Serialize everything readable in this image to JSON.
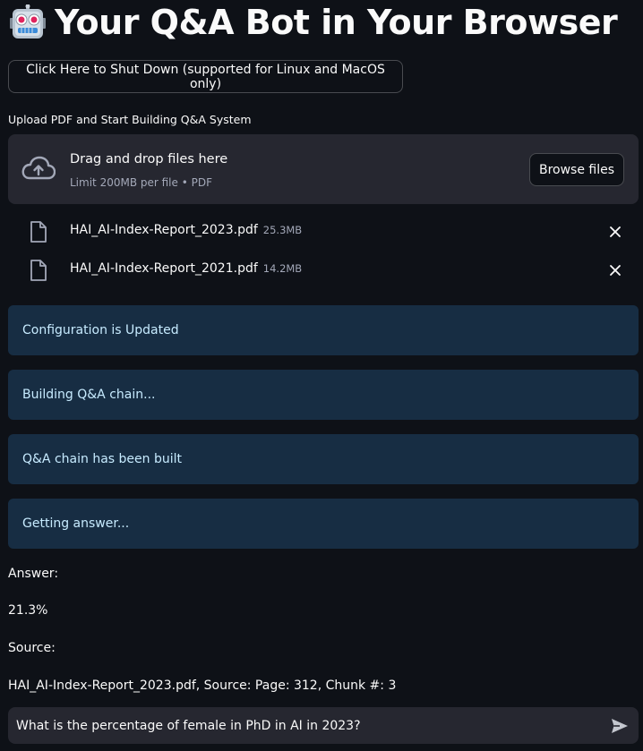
{
  "header": {
    "title": "Your Q&A Bot in Your Browser",
    "icon": "robot-icon"
  },
  "shutdown_button": {
    "label": "Click Here to Shut Down (supported for Linux and MacOS only)"
  },
  "uploader": {
    "label": "Upload PDF and Start Building Q&A System",
    "drop_title": "Drag and drop files here",
    "drop_limit": "Limit 200MB per file • PDF",
    "browse_label": "Browse files",
    "files": [
      {
        "name": "HAI_AI-Index-Report_2023.pdf",
        "size": "25.3MB"
      },
      {
        "name": "HAI_AI-Index-Report_2021.pdf",
        "size": "14.2MB"
      }
    ]
  },
  "status_messages": [
    "Configuration is Updated",
    "Building Q&A chain...",
    "Q&A chain has been built",
    "Getting answer..."
  ],
  "result": {
    "answer_label": "Answer:",
    "answer_value": "21.3%",
    "source_label": "Source:",
    "source_value": "HAI_AI-Index-Report_2023.pdf, Source: Page: 312, Chunk #: 3"
  },
  "chat": {
    "input_value": "What is the percentage of female in PhD in AI in 2023?"
  },
  "colors": {
    "background": "#0e1117",
    "panel": "#262730",
    "info_bg": "#172d43",
    "info_text": "#c7ebff"
  }
}
